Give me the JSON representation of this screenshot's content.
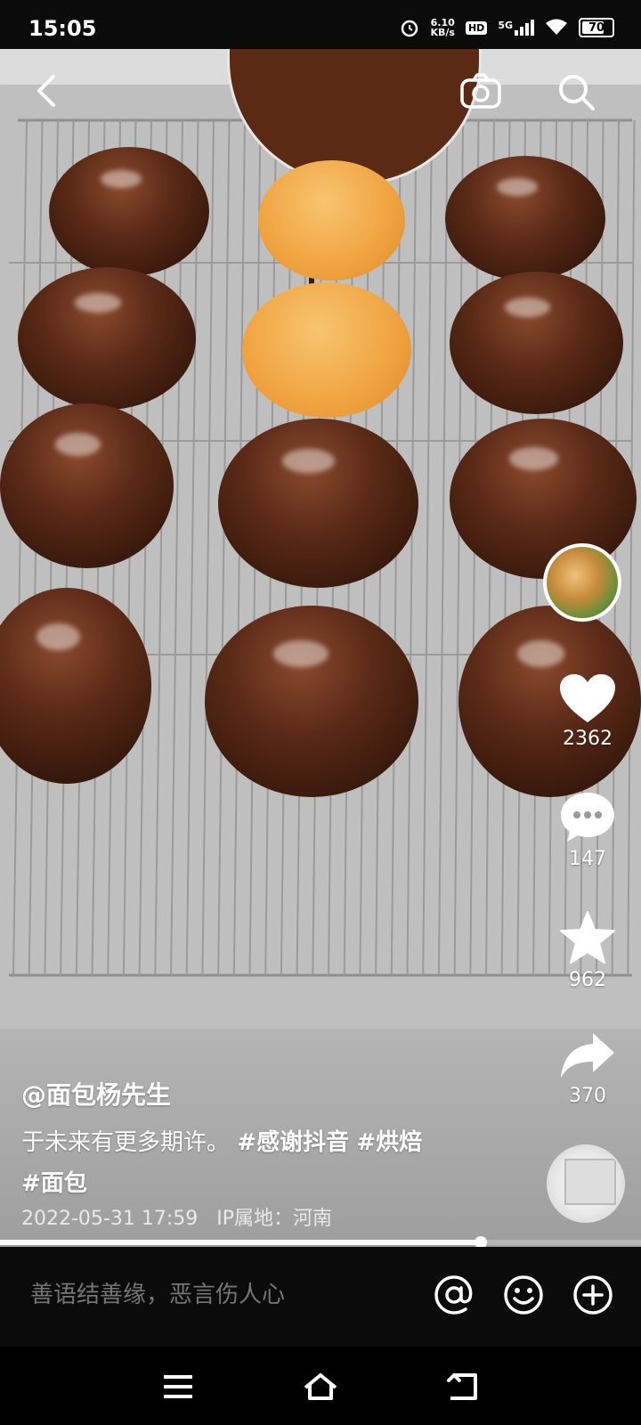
{
  "status": {
    "time": "15:05",
    "net_speed_value": "6.10",
    "net_speed_unit": "KB/s",
    "hd": "HD",
    "network": "5G",
    "battery": "70"
  },
  "author": "@面包杨先生",
  "description": {
    "text": "于未来有更多期许。",
    "tags": [
      "#感谢抖音",
      "#烘焙",
      "#面包"
    ]
  },
  "meta": {
    "date": "2022-05-31 17:59",
    "ip": "IP属地：河南"
  },
  "actions": {
    "likes": "2362",
    "comments": "147",
    "favorites": "962",
    "shares": "370"
  },
  "progress": 0.75,
  "comment_placeholder": "善语结善缘，恶言伤人心",
  "icons": {
    "back": "back-arrow-icon",
    "camera": "camera-icon",
    "search": "search-icon",
    "like": "heart-icon",
    "comment": "comment-bubble-icon",
    "favorite": "star-icon",
    "share": "share-arrow-icon",
    "mention": "at-icon",
    "emoji": "emoji-icon",
    "add": "plus-icon"
  }
}
